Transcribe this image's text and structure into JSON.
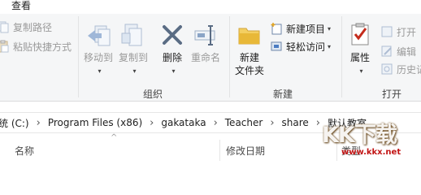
{
  "ribbon_tabs": {
    "view": "查看"
  },
  "clipboard": {
    "copy_path": "复制路径",
    "paste_shortcut": "粘贴快捷方式",
    "group_label": ""
  },
  "organize": {
    "move_to": "移动到",
    "copy_to": "复制到",
    "delete": "删除",
    "rename": "重命名",
    "group_label": "组织"
  },
  "new_group": {
    "new_folder_line1": "新建",
    "new_folder_line2": "文件夹",
    "new_item": "新建项目",
    "easy_access": "轻松访问",
    "group_label": "新建"
  },
  "open_group": {
    "properties": "属性",
    "open": "打开",
    "edit": "编辑",
    "history": "历史记",
    "group_label": "打开"
  },
  "address_bar": {
    "crumbs": [
      "统 (C:)",
      "Program Files (x86)",
      "gakataka",
      "Teacher",
      "share",
      "默认教室"
    ]
  },
  "columns": {
    "name": "名称",
    "date_modified": "修改日期",
    "type": "类型"
  },
  "watermark": {
    "big": "KK下载",
    "url": "www.kkx.net"
  },
  "colors": {
    "ribbon_bg": "#f5f6f7",
    "folder_yellow": "#e8b838",
    "delete_red": "#c42b1c",
    "disabled_blue": "#a9bcd6",
    "watermark_url": "#c21414"
  }
}
